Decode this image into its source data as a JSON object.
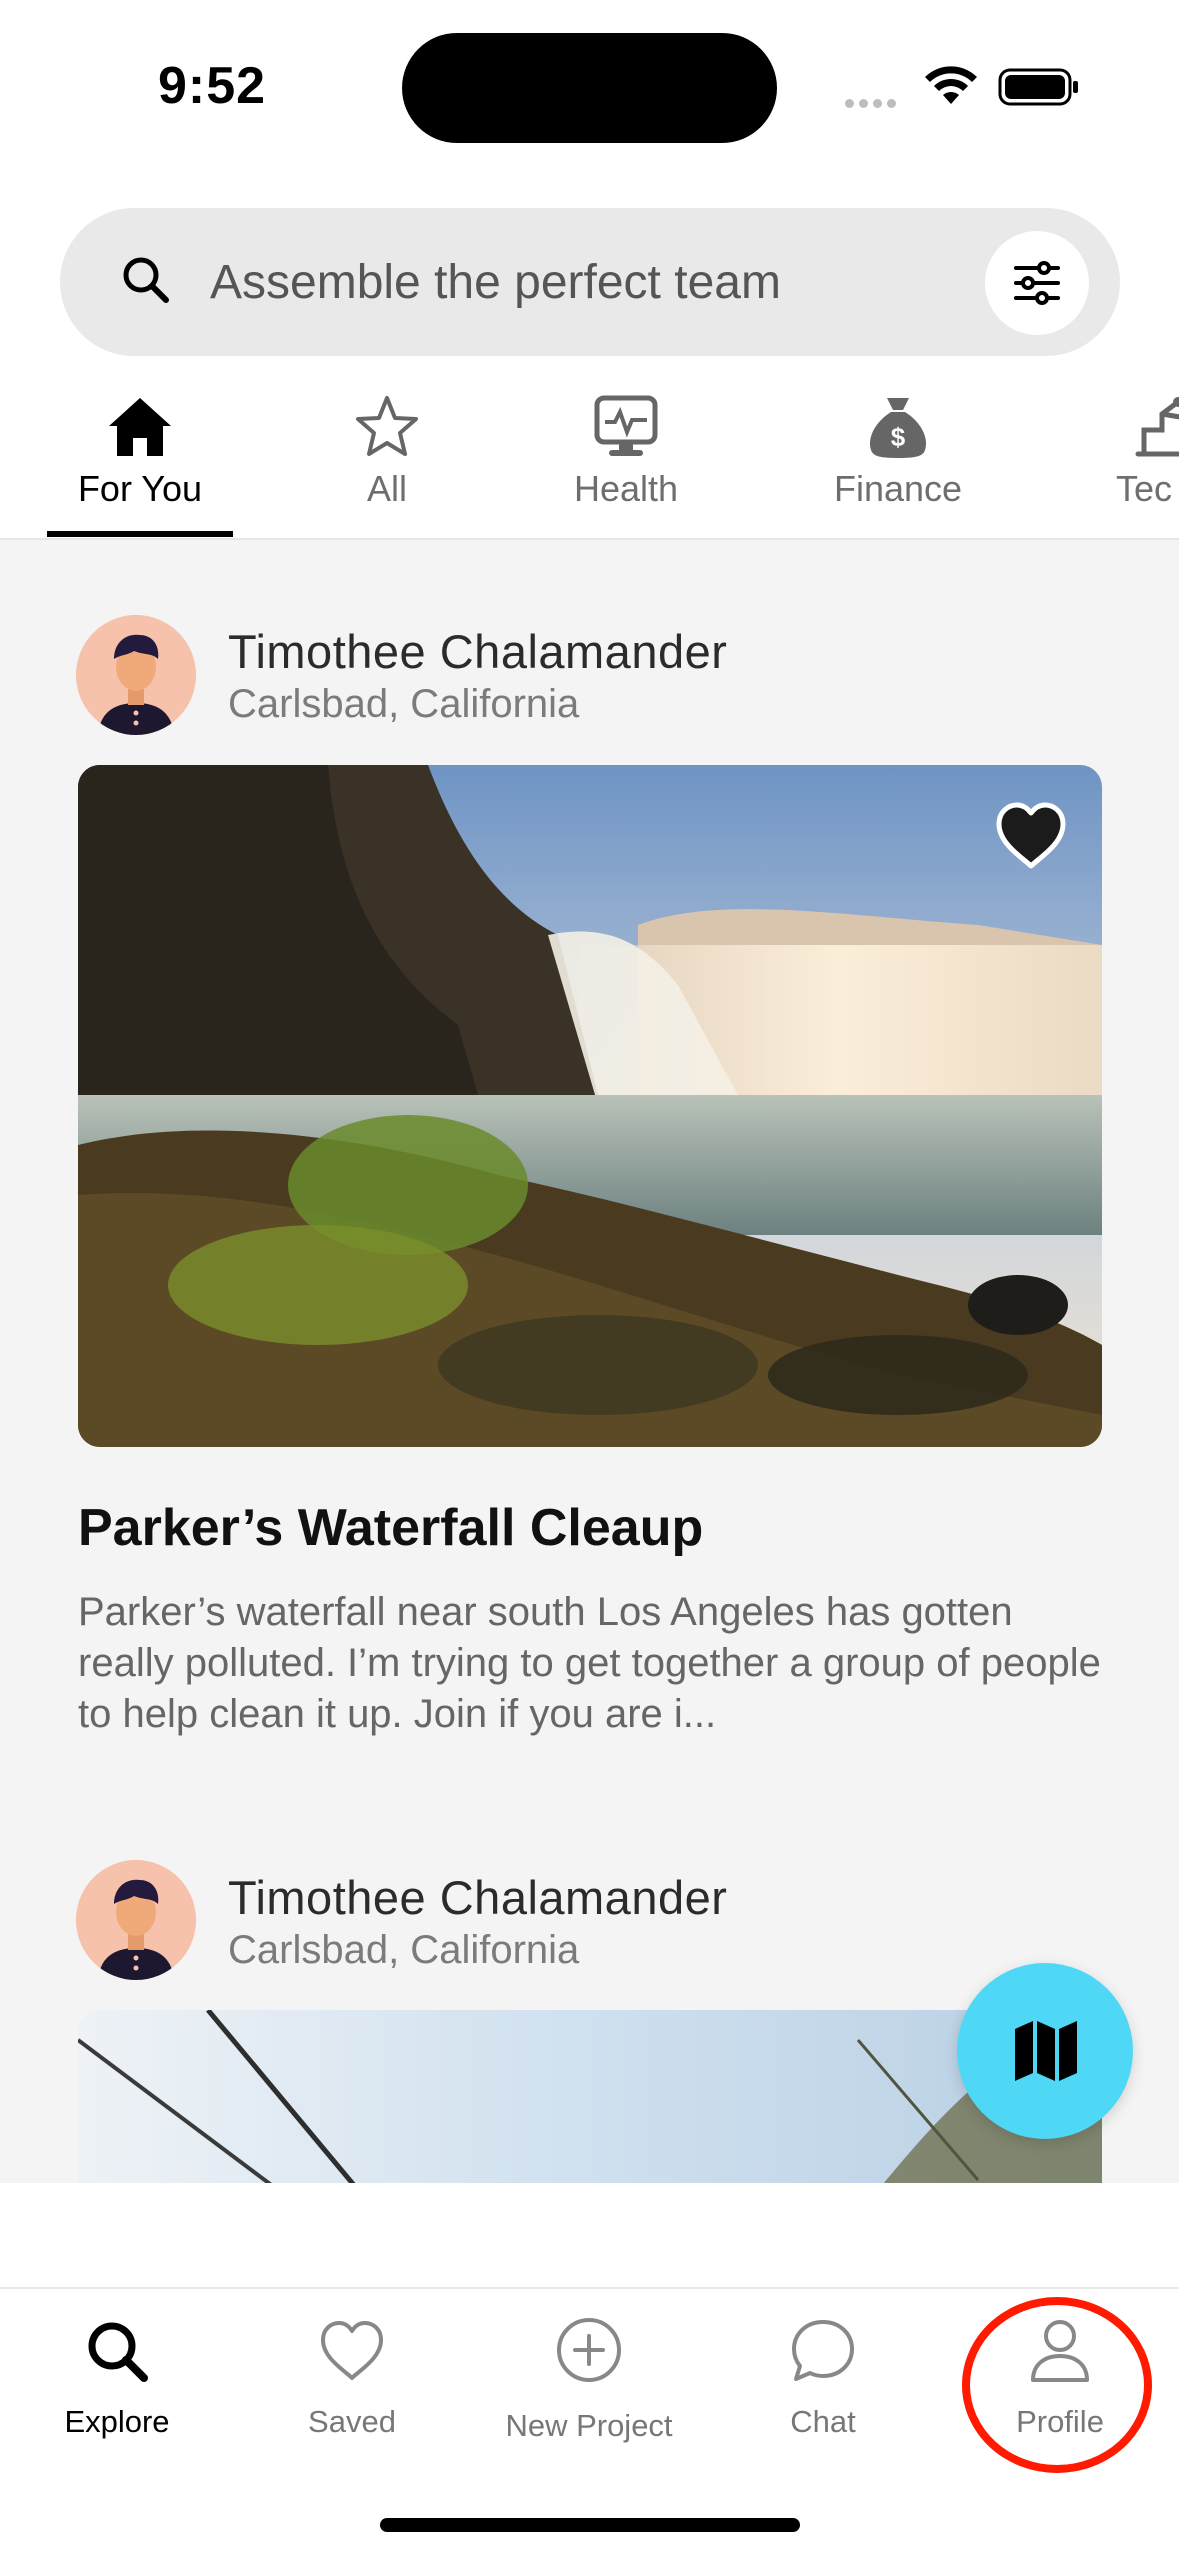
{
  "status_bar": {
    "time": "9:52"
  },
  "search": {
    "placeholder": "Assemble the perfect team"
  },
  "tabs": [
    {
      "label": "For You",
      "icon": "home-icon",
      "active": true
    },
    {
      "label": "All",
      "icon": "star-icon"
    },
    {
      "label": "Health",
      "icon": "health-monitor-icon"
    },
    {
      "label": "Finance",
      "icon": "money-bag-icon"
    },
    {
      "label": "Tec",
      "icon": "tech-icon"
    }
  ],
  "posts": [
    {
      "author": "Timothee Chalamander",
      "location": "Carlsbad, California",
      "title": "Parker’s Waterfall Cleaup",
      "description": "Parker’s waterfall near  south Los Angeles has gotten really polluted. I’m trying to get together a group of people to help clean it up. Join if you are i..."
    },
    {
      "author": "Timothee Chalamander",
      "location": "Carlsbad, California"
    }
  ],
  "bottom_nav": [
    {
      "label": "Explore",
      "icon": "search-icon",
      "active": true
    },
    {
      "label": "Saved",
      "icon": "heart-icon"
    },
    {
      "label": "New Project",
      "icon": "plus-circle-icon"
    },
    {
      "label": "Chat",
      "icon": "chat-bubble-icon"
    },
    {
      "label": "Profile",
      "icon": "person-icon",
      "highlighted": true
    }
  ],
  "colors": {
    "accent_fab": "#4fd8f5",
    "highlight_ring": "#ff1a00",
    "feed_background": "#f4f4f4",
    "avatar_background": "#f7c2ac"
  }
}
